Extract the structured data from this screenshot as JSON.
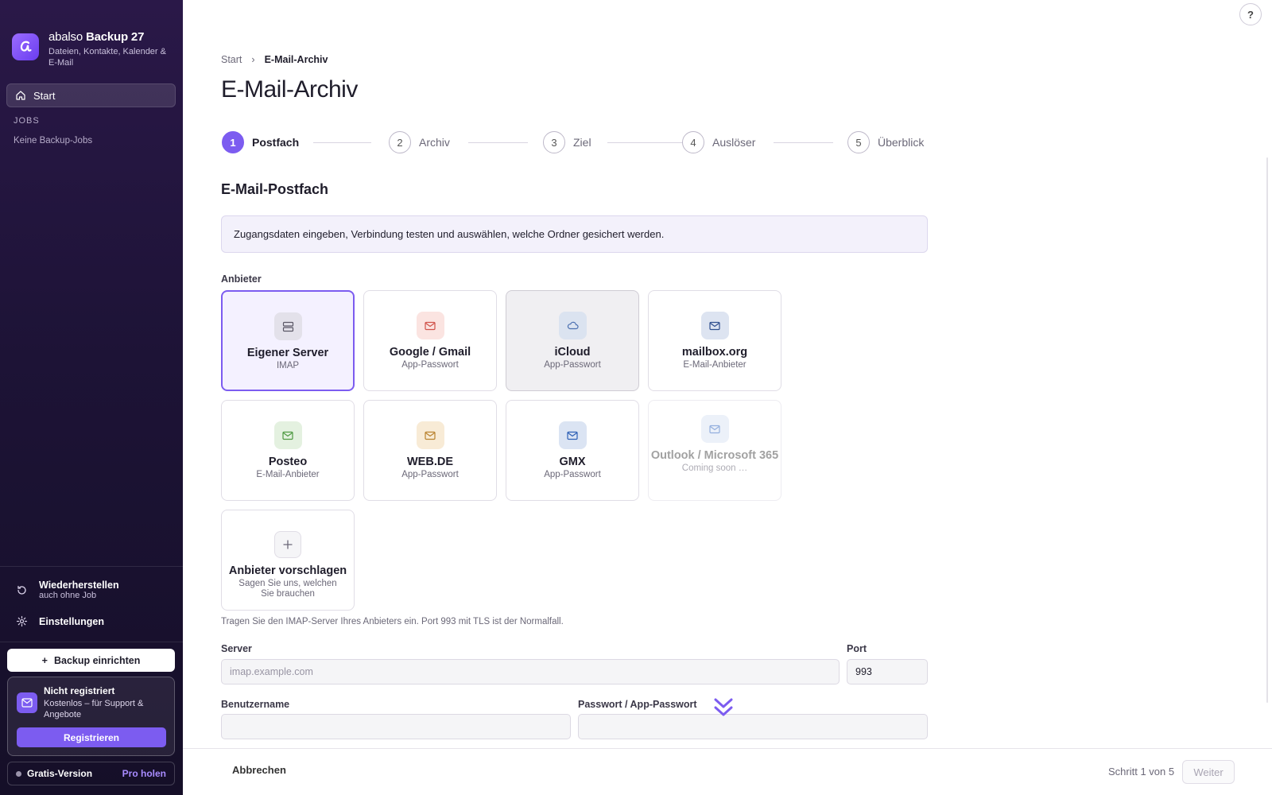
{
  "sidebar": {
    "brand_name": "abalso",
    "brand_product": "Backup 27",
    "brand_sub": "Dateien, Kontakte, Kalender & E-Mail",
    "nav_start": "Start",
    "jobs_label": "JOBS",
    "no_jobs": "Keine Backup-Jobs",
    "restore_label": "Wiederherstellen",
    "restore_sub": "auch ohne Job",
    "settings_label": "Einstellungen",
    "setup_button": "Backup einrichten",
    "reg_title": "Nicht registriert",
    "reg_sub": "Kostenlos – für Support & Angebote",
    "reg_button": "Registrieren",
    "version": "Gratis-Version",
    "pro_link": "Pro holen"
  },
  "main": {
    "help": "?",
    "breadcrumb_root": "Start",
    "breadcrumb_sep": "›",
    "breadcrumb_current": "E-Mail-Archiv",
    "title": "E-Mail-Archiv",
    "steps": [
      {
        "num": "1",
        "label": "Postfach"
      },
      {
        "num": "2",
        "label": "Archiv"
      },
      {
        "num": "3",
        "label": "Ziel"
      },
      {
        "num": "4",
        "label": "Auslöser"
      },
      {
        "num": "5",
        "label": "Überblick"
      }
    ],
    "section_title": "E-Mail-Postfach",
    "info_text": "Zugangsdaten eingeben, Verbindung testen und auswählen, welche Ordner gesichert werden.",
    "provider_label": "Anbieter",
    "providers": [
      {
        "name": "Eigener Server",
        "sub": "IMAP",
        "icon": "server-icon"
      },
      {
        "name": "Google / Gmail",
        "sub": "App-Passwort",
        "icon": "mail-icon"
      },
      {
        "name": "iCloud",
        "sub": "App-Passwort",
        "icon": "cloud-icon"
      },
      {
        "name": "mailbox.org",
        "sub": "E-Mail-Anbieter",
        "icon": "mail-icon"
      },
      {
        "name": "Posteo",
        "sub": "E-Mail-Anbieter",
        "icon": "mail-icon"
      },
      {
        "name": "WEB.DE",
        "sub": "App-Passwort",
        "icon": "mail-icon"
      },
      {
        "name": "GMX",
        "sub": "App-Passwort",
        "icon": "mail-icon"
      },
      {
        "name": "Outlook / Microsoft 365",
        "sub": "Coming soon …",
        "icon": "mail-icon"
      },
      {
        "name": "Anbieter vorschlagen",
        "sub": "Sagen Sie uns, welchen Sie brauchen",
        "icon": "plus-icon"
      }
    ],
    "hint": "Tragen Sie den IMAP-Server Ihres Anbieters ein. Port 993 mit TLS ist der Normalfall.",
    "server_label": "Server",
    "server_placeholder": "imap.example.com",
    "server_value": "",
    "port_label": "Port",
    "port_value": "993",
    "username_label": "Benutzername",
    "username_value": "",
    "password_label": "Passwort / App-Passwort",
    "password_value": ""
  },
  "footer": {
    "cancel": "Abbrechen",
    "step_count": "Schritt 1 von 5",
    "next": "Weiter"
  },
  "colors": {
    "accent": "#7c5cf0",
    "sidebar_bg": "#1d1336"
  }
}
